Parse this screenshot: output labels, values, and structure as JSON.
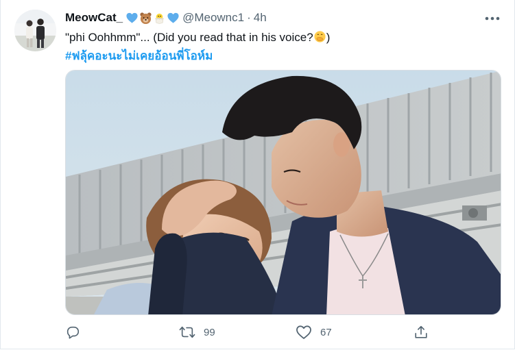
{
  "tweet": {
    "author": {
      "display_name": "MeowCat_",
      "handle": "@Meownc1",
      "separator": "·",
      "time": "4h",
      "badges": [
        "blue-heart-icon",
        "bear-face-icon",
        "hatching-chick-icon",
        "blue-heart-icon"
      ]
    },
    "text": "\"phi Oohhmm\"... (Did you read that in his voice?",
    "text_end": ")",
    "text_emoji": "face-with-hand-over-mouth-icon",
    "hashtag": "#ฟลุ้คอะนะไม่เคยอ้อนพี่โอห์ม",
    "media": {
      "type": "photo"
    },
    "actions": {
      "reply": {
        "icon": "reply-icon",
        "count": ""
      },
      "retweet": {
        "icon": "retweet-icon",
        "count": "99"
      },
      "like": {
        "icon": "heart-icon",
        "count": "67"
      },
      "share": {
        "icon": "share-icon",
        "count": ""
      }
    }
  },
  "colors": {
    "accent": "#1d9bf0",
    "secondary_text": "#536471",
    "primary_text": "#0f1419"
  }
}
